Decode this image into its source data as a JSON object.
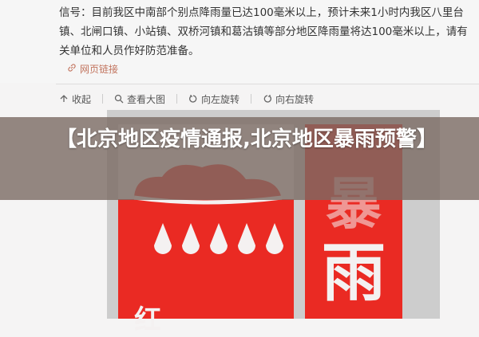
{
  "article": {
    "text": "信号：目前我区中南部个别点降雨量已达100毫米以上，预计未来1小时内我区八里台镇、北闸口镇、小站镇、双桥河镇和葛沽镇等部分地区降雨量将达100毫米以上，请有关单位和人员作好防范准备。",
    "link_label": "网页链接"
  },
  "toolbar": {
    "collapse": "收起",
    "view_large": "查看大图",
    "rotate_left": "向左旋转",
    "rotate_right": "向右旋转"
  },
  "image": {
    "char_1": "暴",
    "char_2": "雨",
    "char_bottom": "红"
  },
  "title": "【北京地区疫情通报,北京地区暴雨预警】",
  "colors": {
    "warning_red": "#ea2a23",
    "link": "#c2745e",
    "overlay": "#7b6a63"
  }
}
